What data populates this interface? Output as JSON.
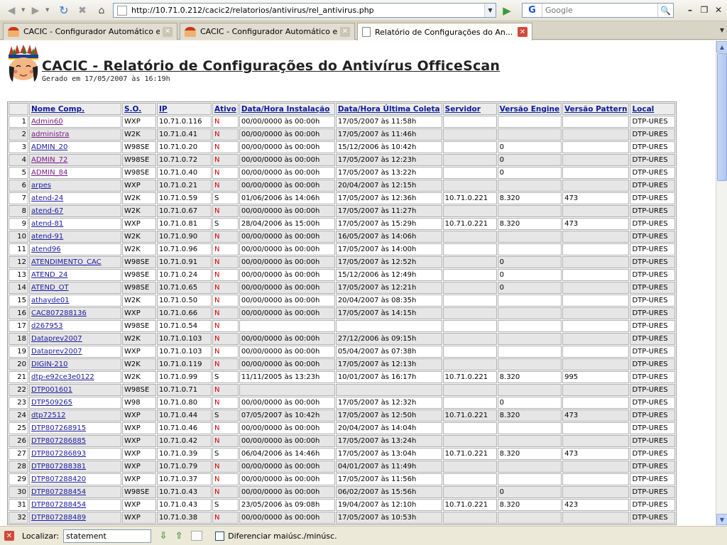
{
  "browser": {
    "url": "http://10.71.0.212/cacic2/relatorios/antivirus/rel_antivirus.php",
    "search_engine": "G",
    "search_placeholder": "Google",
    "tabs": [
      {
        "label": "CACIC - Configurador Automático e C..."
      },
      {
        "label": "CACIC - Configurador Automático e C..."
      },
      {
        "label": "Relatório de Configurações do An..."
      }
    ]
  },
  "report": {
    "title": "CACIC - Relatório de Configurações do Antivírus OfficeScan",
    "subtitle": "Gerado em 17/05/2007 às 16:19h",
    "columns": [
      "Nome Comp.",
      "S.O.",
      "IP",
      "Ativo",
      "Data/Hora Instalação",
      "Data/Hora Última Coleta",
      "Servidor",
      "Versão Engine",
      "Versão Pattern",
      "Local"
    ],
    "rows": [
      [
        "1",
        "Admin60",
        "WXP",
        "10.71.0.116",
        "N",
        "00/00/0000 às 00:00h",
        "17/05/2007 às 11:58h",
        "",
        "",
        "",
        "DTP-URES"
      ],
      [
        "2",
        "administra",
        "W2K",
        "10.71.0.41",
        "N",
        "00/00/0000 às 00:00h",
        "17/05/2007 às 11:46h",
        "",
        "",
        "",
        "DTP-URES"
      ],
      [
        "3",
        "ADMIN_20",
        "W98SE",
        "10.71.0.20",
        "N",
        "00/00/0000 às 00:00h",
        "15/12/2006 às 10:42h",
        "",
        "0",
        "",
        "DTP-URES"
      ],
      [
        "4",
        "ADMIN_72",
        "W98SE",
        "10.71.0.72",
        "N",
        "00/00/0000 às 00:00h",
        "17/05/2007 às 12:23h",
        "",
        "0",
        "",
        "DTP-URES"
      ],
      [
        "5",
        "ADMIN_84",
        "W98SE",
        "10.71.0.40",
        "N",
        "00/00/0000 às 00:00h",
        "17/05/2007 às 13:22h",
        "",
        "0",
        "",
        "DTP-URES"
      ],
      [
        "6",
        "arpes",
        "WXP",
        "10.71.0.21",
        "N",
        "00/00/0000 às 00:00h",
        "20/04/2007 às 12:15h",
        "",
        "",
        "",
        "DTP-URES"
      ],
      [
        "7",
        "atend-24",
        "W2K",
        "10.71.0.59",
        "S",
        "01/06/2006 às 14:06h",
        "17/05/2007 às 12:36h",
        "10.71.0.221",
        "8.320",
        "473",
        "DTP-URES"
      ],
      [
        "8",
        "atend-67",
        "W2K",
        "10.71.0.67",
        "N",
        "00/00/0000 às 00:00h",
        "17/05/2007 às 11:27h",
        "",
        "",
        "",
        "DTP-URES"
      ],
      [
        "9",
        "atend-81",
        "WXP",
        "10.71.0.81",
        "S",
        "28/04/2006 às 15:00h",
        "17/05/2007 às 15:29h",
        "10.71.0.221",
        "8.320",
        "473",
        "DTP-URES"
      ],
      [
        "10",
        "atend-91",
        "W2K",
        "10.71.0.90",
        "N",
        "00/00/0000 às 00:00h",
        "16/05/2007 às 14:06h",
        "",
        "",
        "",
        "DTP-URES"
      ],
      [
        "11",
        "atend96",
        "W2K",
        "10.71.0.96",
        "N",
        "00/00/0000 às 00:00h",
        "17/05/2007 às 14:00h",
        "",
        "",
        "",
        "DTP-URES"
      ],
      [
        "12",
        "ATENDIMENTO_CAC",
        "W98SE",
        "10.71.0.91",
        "N",
        "00/00/0000 às 00:00h",
        "17/05/2007 às 12:52h",
        "",
        "0",
        "",
        "DTP-URES"
      ],
      [
        "13",
        "ATEND_24",
        "W98SE",
        "10.71.0.24",
        "N",
        "00/00/0000 às 00:00h",
        "15/12/2006 às 12:49h",
        "",
        "0",
        "",
        "DTP-URES"
      ],
      [
        "14",
        "ATEND_OT",
        "W98SE",
        "10.71.0.65",
        "N",
        "00/00/0000 às 00:00h",
        "17/05/2007 às 12:21h",
        "",
        "0",
        "",
        "DTP-URES"
      ],
      [
        "15",
        "athayde01",
        "W2K",
        "10.71.0.50",
        "N",
        "00/00/0000 às 00:00h",
        "20/04/2007 às 08:35h",
        "",
        "",
        "",
        "DTP-URES"
      ],
      [
        "16",
        "CAC807288136",
        "WXP",
        "10.71.0.66",
        "N",
        "00/00/0000 às 00:00h",
        "17/05/2007 às 14:15h",
        "",
        "",
        "",
        "DTP-URES"
      ],
      [
        "17",
        "d267953",
        "W98SE",
        "10.71.0.54",
        "N",
        "",
        "",
        "",
        "",
        "",
        "DTP-URES"
      ],
      [
        "18",
        "Dataprev2007",
        "W2K",
        "10.71.0.103",
        "N",
        "00/00/0000 às 00:00h",
        "27/12/2006 às 09:15h",
        "",
        "",
        "",
        "DTP-URES"
      ],
      [
        "19",
        "Dataprev2007",
        "WXP",
        "10.71.0.103",
        "N",
        "00/00/0000 às 00:00h",
        "05/04/2007 às 07:38h",
        "",
        "",
        "",
        "DTP-URES"
      ],
      [
        "20",
        "DIGIN-210",
        "W2K",
        "10.71.0.119",
        "N",
        "00/00/0000 às 00:00h",
        "17/05/2007 às 12:13h",
        "",
        "",
        "",
        "DTP-URES"
      ],
      [
        "21",
        "dtp-e92ce3e0122",
        "W2K",
        "10.71.0.99",
        "S",
        "11/11/2005 às 13:23h",
        "10/01/2007 às 16:17h",
        "10.71.0.221",
        "8.320",
        "995",
        "DTP-URES"
      ],
      [
        "22",
        "DTP001601",
        "W98SE",
        "10.71.0.71",
        "N",
        "",
        "",
        "",
        "",
        "",
        "DTP-URES"
      ],
      [
        "23",
        "DTP509265",
        "W98",
        "10.71.0.80",
        "N",
        "00/00/0000 às 00:00h",
        "17/05/2007 às 12:32h",
        "",
        "0",
        "",
        "DTP-URES"
      ],
      [
        "24",
        "dtp72512",
        "WXP",
        "10.71.0.44",
        "S",
        "07/05/2007 às 10:42h",
        "17/05/2007 às 12:50h",
        "10.71.0.221",
        "8.320",
        "473",
        "DTP-URES"
      ],
      [
        "25",
        "DTP807268915",
        "WXP",
        "10.71.0.46",
        "N",
        "00/00/0000 às 00:00h",
        "20/04/2007 às 14:04h",
        "",
        "",
        "",
        "DTP-URES"
      ],
      [
        "26",
        "DTP807286885",
        "WXP",
        "10.71.0.42",
        "N",
        "00/00/0000 às 00:00h",
        "17/05/2007 às 13:24h",
        "",
        "",
        "",
        "DTP-URES"
      ],
      [
        "27",
        "DTP807286893",
        "WXP",
        "10.71.0.39",
        "S",
        "06/04/2006 às 14:46h",
        "17/05/2007 às 13:04h",
        "10.71.0.221",
        "8.320",
        "473",
        "DTP-URES"
      ],
      [
        "28",
        "DTP807288381",
        "WXP",
        "10.71.0.79",
        "N",
        "00/00/0000 às 00:00h",
        "04/01/2007 às 11:49h",
        "",
        "",
        "",
        "DTP-URES"
      ],
      [
        "29",
        "DTP807288420",
        "WXP",
        "10.71.0.37",
        "N",
        "00/00/0000 às 00:00h",
        "17/05/2007 às 11:56h",
        "",
        "",
        "",
        "DTP-URES"
      ],
      [
        "30",
        "DTP807288454",
        "W98SE",
        "10.71.0.43",
        "N",
        "00/00/0000 às 00:00h",
        "06/02/2007 às 15:56h",
        "",
        "0",
        "",
        "DTP-URES"
      ],
      [
        "31",
        "DTP807288454",
        "WXP",
        "10.71.0.43",
        "S",
        "23/05/2006 às 09:08h",
        "19/04/2007 às 12:10h",
        "10.71.0.221",
        "8.320",
        "423",
        "DTP-URES"
      ],
      [
        "32",
        "DTP807288489",
        "WXP",
        "10.71.0.38",
        "N",
        "00/00/0000 às 00:00h",
        "17/05/2007 às 10:53h",
        "",
        "",
        "",
        "DTP-URES"
      ]
    ],
    "visited_rows": [
      1,
      2,
      4,
      5
    ]
  },
  "findbar": {
    "label": "Localizar:",
    "query": "statement",
    "match_case_label": "Diferenciar maiúsc./minúsc."
  },
  "colors": {
    "link": "#1a1aa0",
    "visited_link": "#7a1a8a",
    "inactive_flag": "#d00000",
    "even_row": "#e6e6e6"
  }
}
